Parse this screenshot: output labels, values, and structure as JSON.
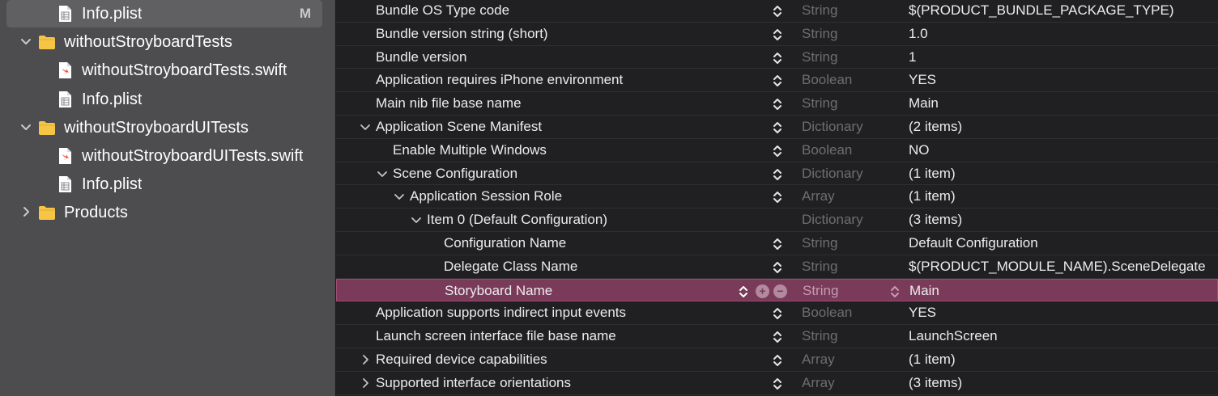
{
  "navigator": {
    "items": [
      {
        "label": "Info.plist",
        "icon": "plist-file-icon",
        "indent": 2,
        "badge": "M",
        "highlighted": true
      },
      {
        "label": "withoutStroyboardTests",
        "icon": "folder-icon",
        "indent": 1,
        "disclosure": "expanded"
      },
      {
        "label": "withoutStroyboardTests.swift",
        "icon": "swift-file-icon",
        "indent": 2
      },
      {
        "label": "Info.plist",
        "icon": "plist-file-icon",
        "indent": 2
      },
      {
        "label": "withoutStroyboardUITests",
        "icon": "folder-icon",
        "indent": 1,
        "disclosure": "expanded"
      },
      {
        "label": "withoutStroyboardUITests.swift",
        "icon": "swift-file-icon",
        "indent": 2
      },
      {
        "label": "Info.plist",
        "icon": "plist-file-icon",
        "indent": 2
      },
      {
        "label": "Products",
        "icon": "folder-icon",
        "indent": 1,
        "disclosure": "collapsed"
      }
    ]
  },
  "plist": {
    "rows": [
      {
        "key": "Bundle OS Type code",
        "type": "String",
        "value": "$(PRODUCT_BUNDLE_PACKAGE_TYPE)",
        "level": 0
      },
      {
        "key": "Bundle version string (short)",
        "type": "String",
        "value": "1.0",
        "level": 0
      },
      {
        "key": "Bundle version",
        "type": "String",
        "value": "1",
        "level": 0
      },
      {
        "key": "Application requires iPhone environment",
        "type": "Boolean",
        "value": "YES",
        "level": 0
      },
      {
        "key": "Main nib file base name",
        "type": "String",
        "value": "Main",
        "level": 0
      },
      {
        "key": "Application Scene Manifest",
        "type": "Dictionary",
        "value": "(2 items)",
        "level": 0,
        "disclosure": "expanded"
      },
      {
        "key": "Enable Multiple Windows",
        "type": "Boolean",
        "value": "NO",
        "level": 1
      },
      {
        "key": "Scene Configuration",
        "type": "Dictionary",
        "value": "(1 item)",
        "level": 1,
        "disclosure": "expanded"
      },
      {
        "key": "Application Session Role",
        "type": "Array",
        "value": "(1 item)",
        "level": 2,
        "disclosure": "expanded"
      },
      {
        "key": "Item 0 (Default Configuration)",
        "type": "Dictionary",
        "value": "(3 items)",
        "level": 3,
        "disclosure": "expanded",
        "no_stepper": true
      },
      {
        "key": "Configuration Name",
        "type": "String",
        "value": "Default Configuration",
        "level": 4
      },
      {
        "key": "Delegate Class Name",
        "type": "String",
        "value": "$(PRODUCT_MODULE_NAME).SceneDelegate",
        "level": 4
      },
      {
        "key": "Storyboard Name",
        "type": "String",
        "value": "Main",
        "level": 4,
        "selected": true
      },
      {
        "key": "Application supports indirect input events",
        "type": "Boolean",
        "value": "YES",
        "level": 0
      },
      {
        "key": "Launch screen interface file base name",
        "type": "String",
        "value": "LaunchScreen",
        "level": 0
      },
      {
        "key": "Required device capabilities",
        "type": "Array",
        "value": "(1 item)",
        "level": 0,
        "disclosure": "collapsed"
      },
      {
        "key": "Supported interface orientations",
        "type": "Array",
        "value": "(3 items)",
        "level": 0,
        "disclosure": "collapsed"
      }
    ]
  },
  "colors": {
    "navigator_bg": "#4d4d4f",
    "editor_bg": "#202022",
    "selection": "#7a3a5a",
    "folder": "#f7c545",
    "swift": "#f05138"
  }
}
